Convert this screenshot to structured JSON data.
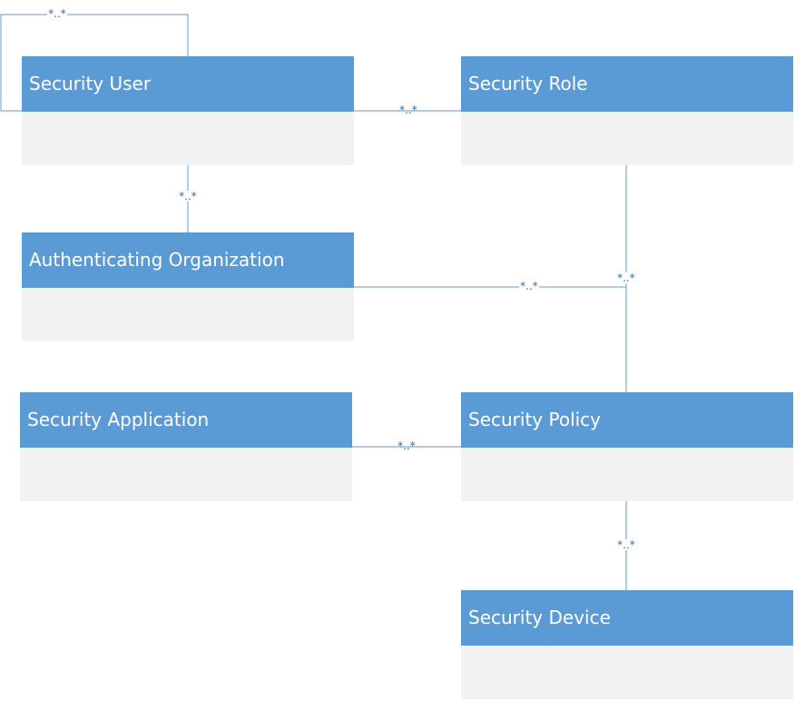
{
  "entities": {
    "security_user": {
      "name": "Security User"
    },
    "security_role": {
      "name": "Security Role"
    },
    "authenticating_organization": {
      "name": "Authenticating Organization"
    },
    "security_application": {
      "name": "Security Application"
    },
    "security_policy": {
      "name": "Security Policy"
    },
    "security_device": {
      "name": "Security Device"
    }
  },
  "multiplicities": {
    "user_self": "*..*",
    "user_role": "*..*",
    "user_org": "*..*",
    "org_policy": "*..*",
    "role_policy": "*..*",
    "application_policy": "*..*",
    "policy_device": "*..*"
  },
  "colors": {
    "header": "#5b9bd5",
    "body": "#f2f2f2",
    "connector": "#5b9bd5"
  }
}
